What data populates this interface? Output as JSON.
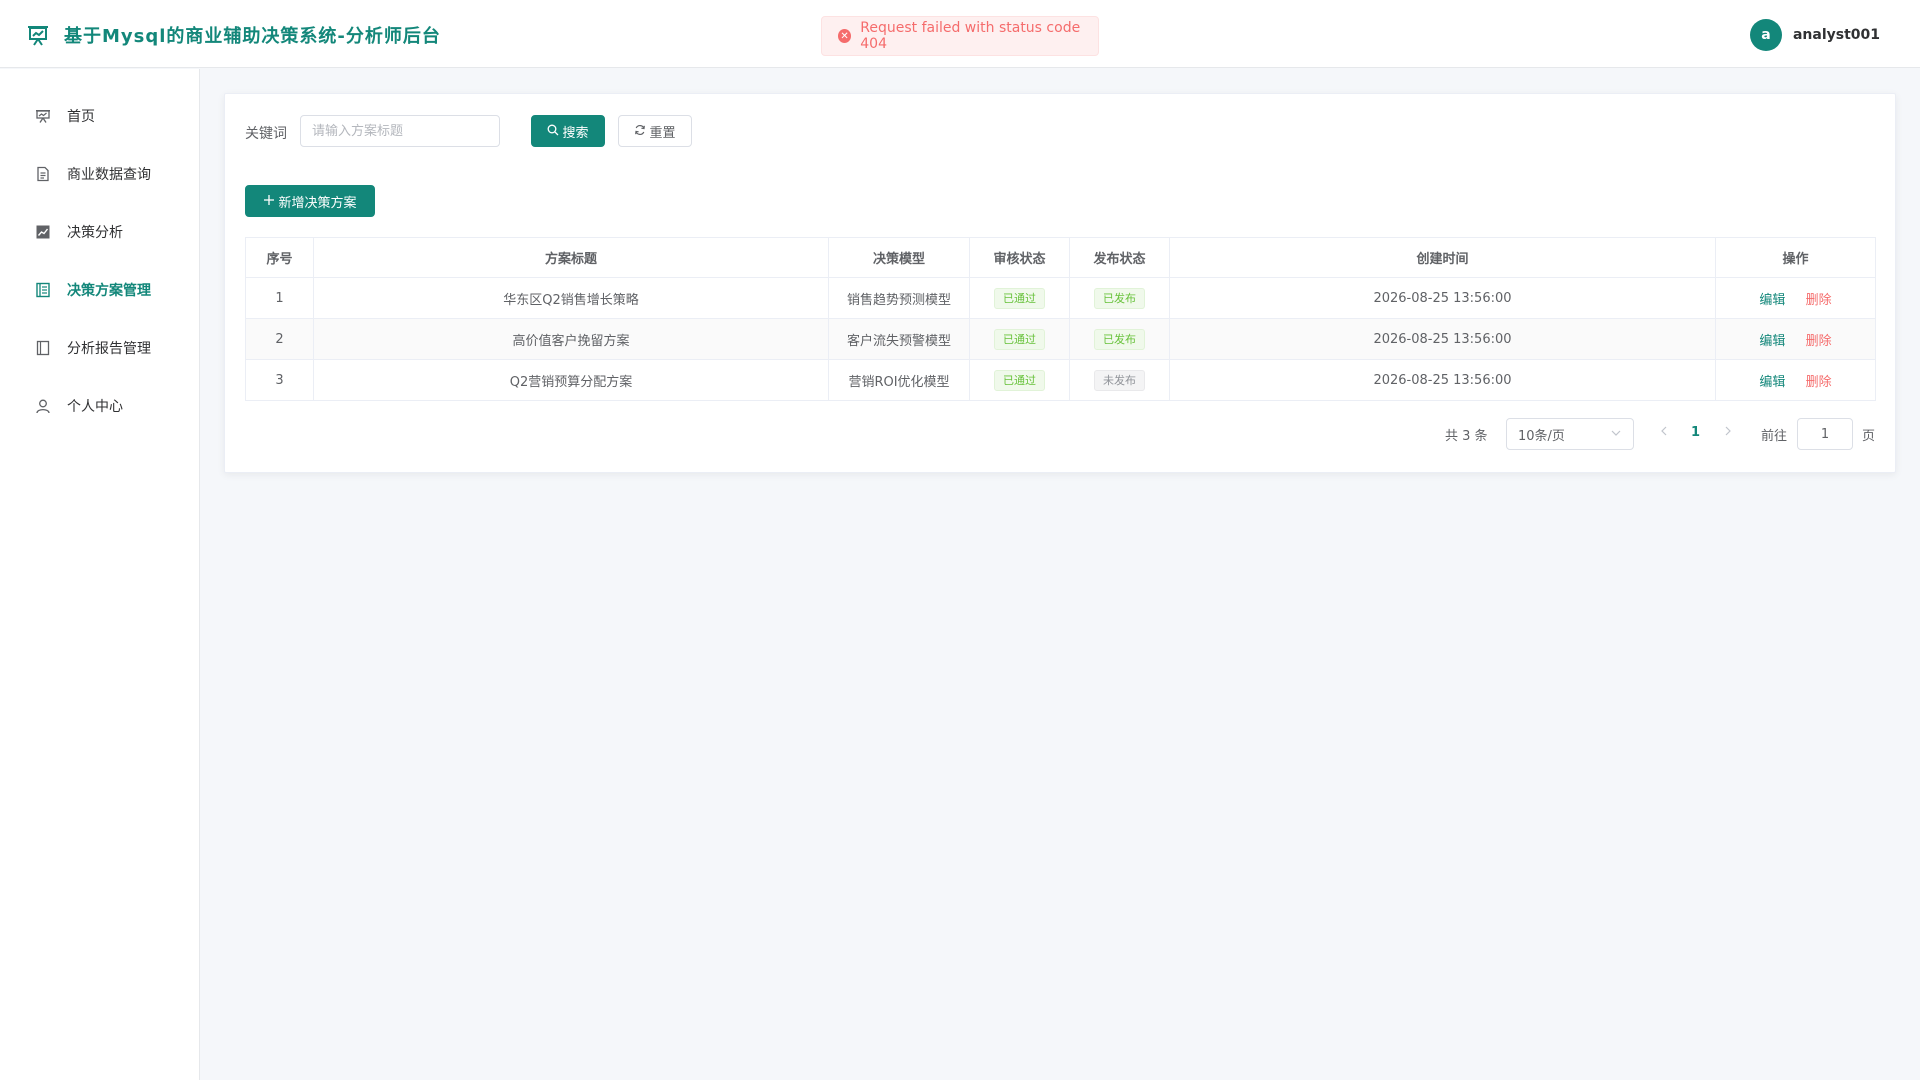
{
  "app": {
    "title": "基于Mysql的商业辅助决策系统-分析师后台"
  },
  "user": {
    "avatar_letter": "a",
    "name": "analyst001"
  },
  "toast": {
    "message": "Request failed with status code 404"
  },
  "sidebar": {
    "items": [
      {
        "label": "首页",
        "icon": "presentation-icon"
      },
      {
        "label": "商业数据查询",
        "icon": "document-icon"
      },
      {
        "label": "决策分析",
        "icon": "chart-icon"
      },
      {
        "label": "决策方案管理",
        "icon": "list-icon",
        "active": true
      },
      {
        "label": "分析报告管理",
        "icon": "notebook-icon"
      },
      {
        "label": "个人中心",
        "icon": "user-icon"
      }
    ]
  },
  "search": {
    "label": "关键词",
    "placeholder": "请输入方案标题",
    "value": "",
    "search_label": "搜索",
    "reset_label": "重置"
  },
  "add_button": {
    "label": "新增决策方案"
  },
  "table": {
    "columns": [
      "序号",
      "方案标题",
      "决策模型",
      "审核状态",
      "发布状态",
      "创建时间",
      "操作"
    ],
    "rows": [
      {
        "index": "1",
        "title": "华东区Q2销售增长策略",
        "model": "销售趋势预测模型",
        "review": "已通过",
        "publish": "已发布",
        "created": "2026-08-25 13:56:00"
      },
      {
        "index": "2",
        "title": "高价值客户挽留方案",
        "model": "客户流失预警模型",
        "review": "已通过",
        "publish": "已发布",
        "created": "2026-08-25 13:56:00"
      },
      {
        "index": "3",
        "title": "Q2营销预算分配方案",
        "model": "营销ROI优化模型",
        "review": "已通过",
        "publish": "未发布",
        "created": "2026-08-25 13:56:00"
      }
    ],
    "edit_label": "编辑",
    "delete_label": "删除"
  },
  "pagination": {
    "total_text": "共 3 条",
    "page_size": "10条/页",
    "current_page": "1",
    "goto_label": "前往",
    "goto_value": "1",
    "page_unit": "页"
  },
  "colors": {
    "accent": "#13877a",
    "danger": "#f56c6c",
    "success": "#67c23a"
  }
}
